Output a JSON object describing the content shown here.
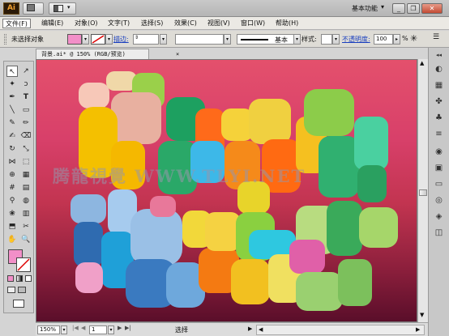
{
  "app": {
    "logo": "Ai",
    "workspace": "基本功能"
  },
  "menus": [
    "文件(F)",
    "编辑(E)",
    "对象(O)",
    "文字(T)",
    "选择(S)",
    "效果(C)",
    "视图(V)",
    "窗口(W)",
    "帮助(H)"
  ],
  "control": {
    "selection": "未选择对象",
    "stroke_label": "描边:",
    "style_label": "基本",
    "styles_label": "样式:",
    "opacity_label": "不透明度:",
    "opacity_value": "100",
    "opacity_unit": "%"
  },
  "document": {
    "tab_title": "背景.ai* @ 150% (RGB/预览)"
  },
  "watermark": "腾龍視覺 WWW.TLYI.NET",
  "status": {
    "zoom": "150%",
    "page": "1",
    "tool": "选择"
  },
  "colors": {
    "fill": "#f28fc8",
    "canvas_top": "#e4506c",
    "canvas_bottom": "#5a0e2a"
  }
}
